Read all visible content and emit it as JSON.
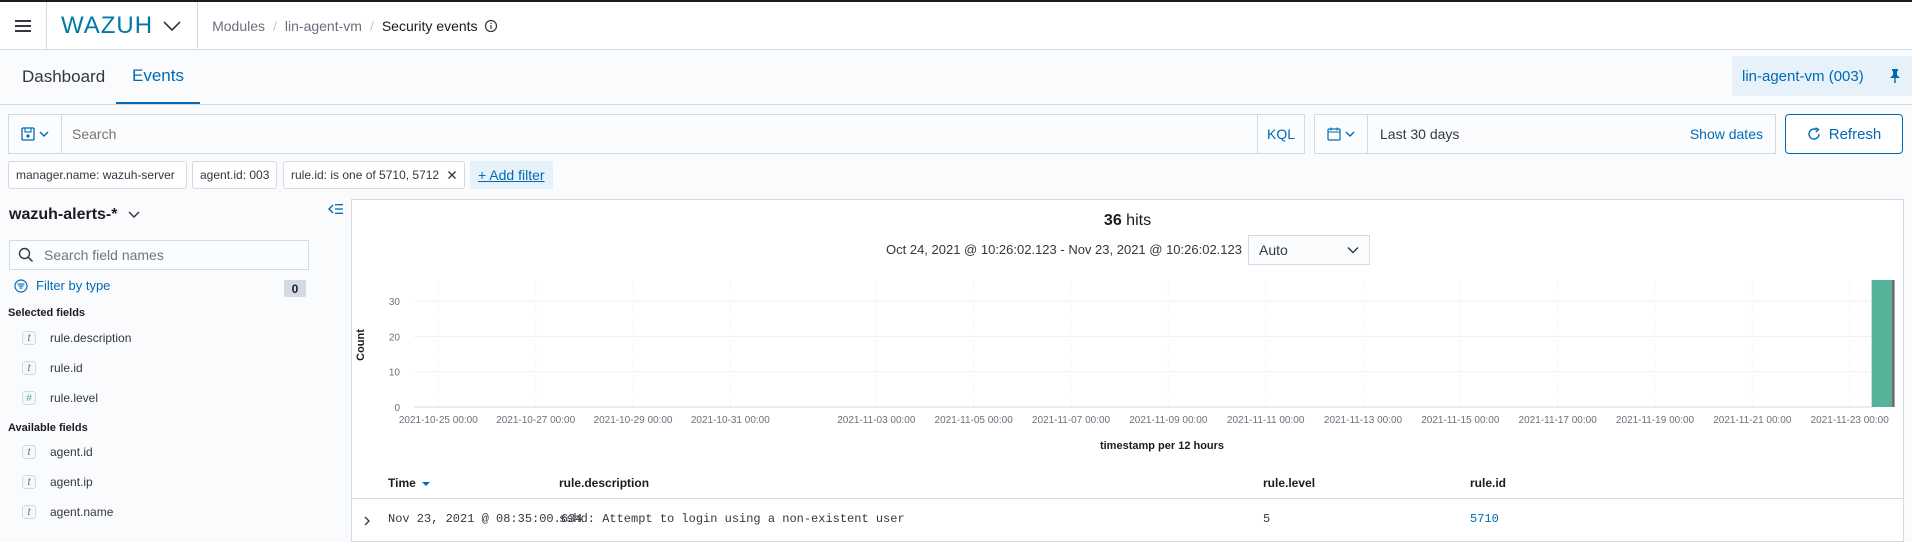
{
  "header": {
    "logo": "WAZUH",
    "breadcrumbs": [
      "Modules",
      "lin-agent-vm"
    ],
    "current": "Security events"
  },
  "tabs": [
    {
      "label": "Dashboard",
      "active": false
    },
    {
      "label": "Events",
      "active": true
    }
  ],
  "agent_pill": "lin-agent-vm (003)",
  "search": {
    "placeholder": "Search",
    "language": "KQL"
  },
  "date_picker": {
    "range": "Last 30 days",
    "show_dates": "Show dates"
  },
  "refresh_label": "Refresh",
  "filters": [
    "manager.name: wazuh-server",
    "agent.id: 003",
    "rule.id: is one of 5710, 5712"
  ],
  "add_filter_label": "+ Add filter",
  "sidebar": {
    "index_pattern": "wazuh-alerts-*",
    "field_search_placeholder": "Search field names",
    "filter_by_type": "Filter by type",
    "filter_count": "0",
    "selected_title": "Selected fields",
    "selected_fields": [
      {
        "type": "t",
        "name": "rule.description"
      },
      {
        "type": "t",
        "name": "rule.id"
      },
      {
        "type": "#",
        "name": "rule.level"
      }
    ],
    "available_title": "Available fields",
    "available_fields": [
      {
        "type": "t",
        "name": "agent.id"
      },
      {
        "type": "t",
        "name": "agent.ip"
      },
      {
        "type": "t",
        "name": "agent.name"
      }
    ]
  },
  "results": {
    "hits_count": "36",
    "hits_label": "hits",
    "date_range": "Oct 24, 2021 @ 10:26:02.123 - Nov 23, 2021 @ 10:26:02.123",
    "interval": "Auto"
  },
  "chart_data": {
    "type": "bar",
    "ylabel": "Count",
    "xlabel": "timestamp per 12 hours",
    "ylim": [
      0,
      36
    ],
    "yticks": [
      0,
      10,
      20,
      30
    ],
    "xticks": [
      "2021-10-25 00:00",
      "2021-10-27 00:00",
      "2021-10-29 00:00",
      "2021-10-31 00:00",
      "2021-11-03 00:00",
      "2021-11-05 00:00",
      "2021-11-07 00:00",
      "2021-11-09 00:00",
      "2021-11-11 00:00",
      "2021-11-13 00:00",
      "2021-11-15 00:00",
      "2021-11-17 00:00",
      "2021-11-19 00:00",
      "2021-11-21 00:00",
      "2021-11-23 00:00"
    ],
    "categories": [
      "2021-11-23 00:00"
    ],
    "series": [
      {
        "values": [
          36
        ],
        "color": "#54b399"
      }
    ],
    "grid": true
  },
  "table": {
    "columns": [
      "Time",
      "rule.description",
      "rule.level",
      "rule.id"
    ],
    "rows": [
      [
        "Nov 23, 2021 @ 08:35:00.634",
        "sshd: Attempt to login using a non-existent user",
        "5",
        "5710"
      ]
    ]
  }
}
